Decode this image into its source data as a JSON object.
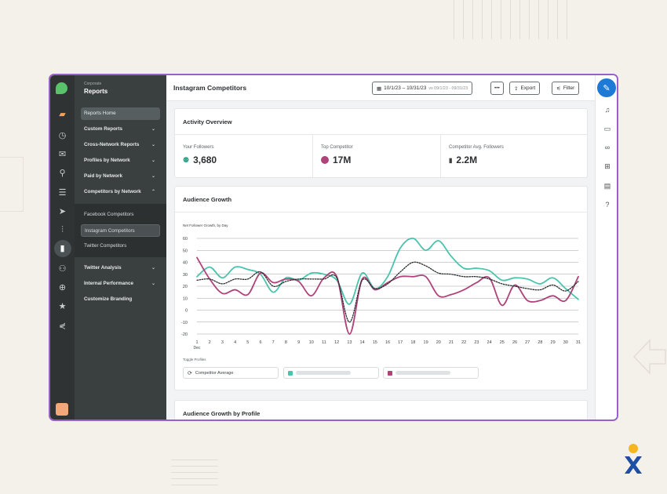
{
  "sidebar": {
    "subtitle": "Corporate",
    "title": "Reports",
    "items": [
      {
        "label": "Reports Home"
      },
      {
        "label": "Custom Reports"
      },
      {
        "label": "Cross-Network Reports"
      },
      {
        "label": "Profiles by Network"
      },
      {
        "label": "Paid by Network"
      },
      {
        "label": "Competitors by Network"
      }
    ],
    "competitor_items": [
      {
        "label": "Facebook Competitors"
      },
      {
        "label": "Instagram Competitors"
      },
      {
        "label": "Twitter Competitors"
      }
    ],
    "bottom_items": [
      {
        "label": "Twitter Analysis"
      },
      {
        "label": "Internal Performance"
      },
      {
        "label": "Customize Branding"
      }
    ]
  },
  "header": {
    "title": "Instagram Competitors",
    "date_range": "10/1/23 – 10/31/23",
    "compare_range": "vs 09/1/23 - 09/31/23",
    "more_label": "•••",
    "export_label": "Export",
    "filter_label": "Filter"
  },
  "activity": {
    "title": "Activity Overview",
    "stats": [
      {
        "label": "Your Followers",
        "value": "3,680"
      },
      {
        "label": "Top Competitor",
        "value": "17M"
      },
      {
        "label": "Competitor Avg. Followers",
        "value": "2.2M"
      }
    ]
  },
  "audience": {
    "title": "Audience Growth",
    "chart_subtitle": "Net Follower Growth, by Day",
    "toggle_label": "Toggle Profiles",
    "toggle_avg": "Competitor Average"
  },
  "audience_by_profile": {
    "title": "Audience Growth by Profile"
  },
  "colors": {
    "teal": "#4cc3ad",
    "magenta": "#b0427a",
    "average": "#2b2f31",
    "accent": "#1f7ad6"
  },
  "chart_data": {
    "type": "line",
    "x": [
      1,
      2,
      3,
      4,
      5,
      6,
      7,
      8,
      9,
      10,
      11,
      12,
      13,
      14,
      15,
      16,
      17,
      18,
      19,
      20,
      21,
      22,
      23,
      24,
      25,
      26,
      27,
      28,
      29,
      30,
      31
    ],
    "x_extra_label": "Dec",
    "ylim": [
      -20,
      60
    ],
    "yticks": [
      60,
      50,
      40,
      30,
      20,
      10,
      0,
      -10,
      -20
    ],
    "grid": true,
    "series": [
      {
        "color": "#4cc3ad",
        "values": [
          28,
          36,
          27,
          36,
          34,
          30,
          15,
          27,
          25,
          31,
          30,
          25,
          5,
          31,
          18,
          28,
          52,
          60,
          50,
          58,
          45,
          35,
          35,
          33,
          25,
          27,
          26,
          22,
          27,
          18,
          9
        ]
      },
      {
        "color": "#b0427a",
        "values": [
          44,
          26,
          14,
          17,
          13,
          31,
          23,
          26,
          24,
          12,
          27,
          28,
          -20,
          26,
          17,
          23,
          28,
          28,
          28,
          12,
          13,
          17,
          23,
          27,
          4,
          21,
          8,
          8,
          12,
          8,
          28
        ]
      },
      {
        "color": "#2b2f31",
        "dashed": true,
        "values": [
          25,
          26,
          22,
          26,
          26,
          32,
          20,
          24,
          26,
          26,
          26,
          27,
          -10,
          25,
          18,
          22,
          32,
          40,
          37,
          31,
          30,
          28,
          28,
          26,
          22,
          20,
          18,
          17,
          21,
          16,
          24
        ]
      }
    ]
  }
}
